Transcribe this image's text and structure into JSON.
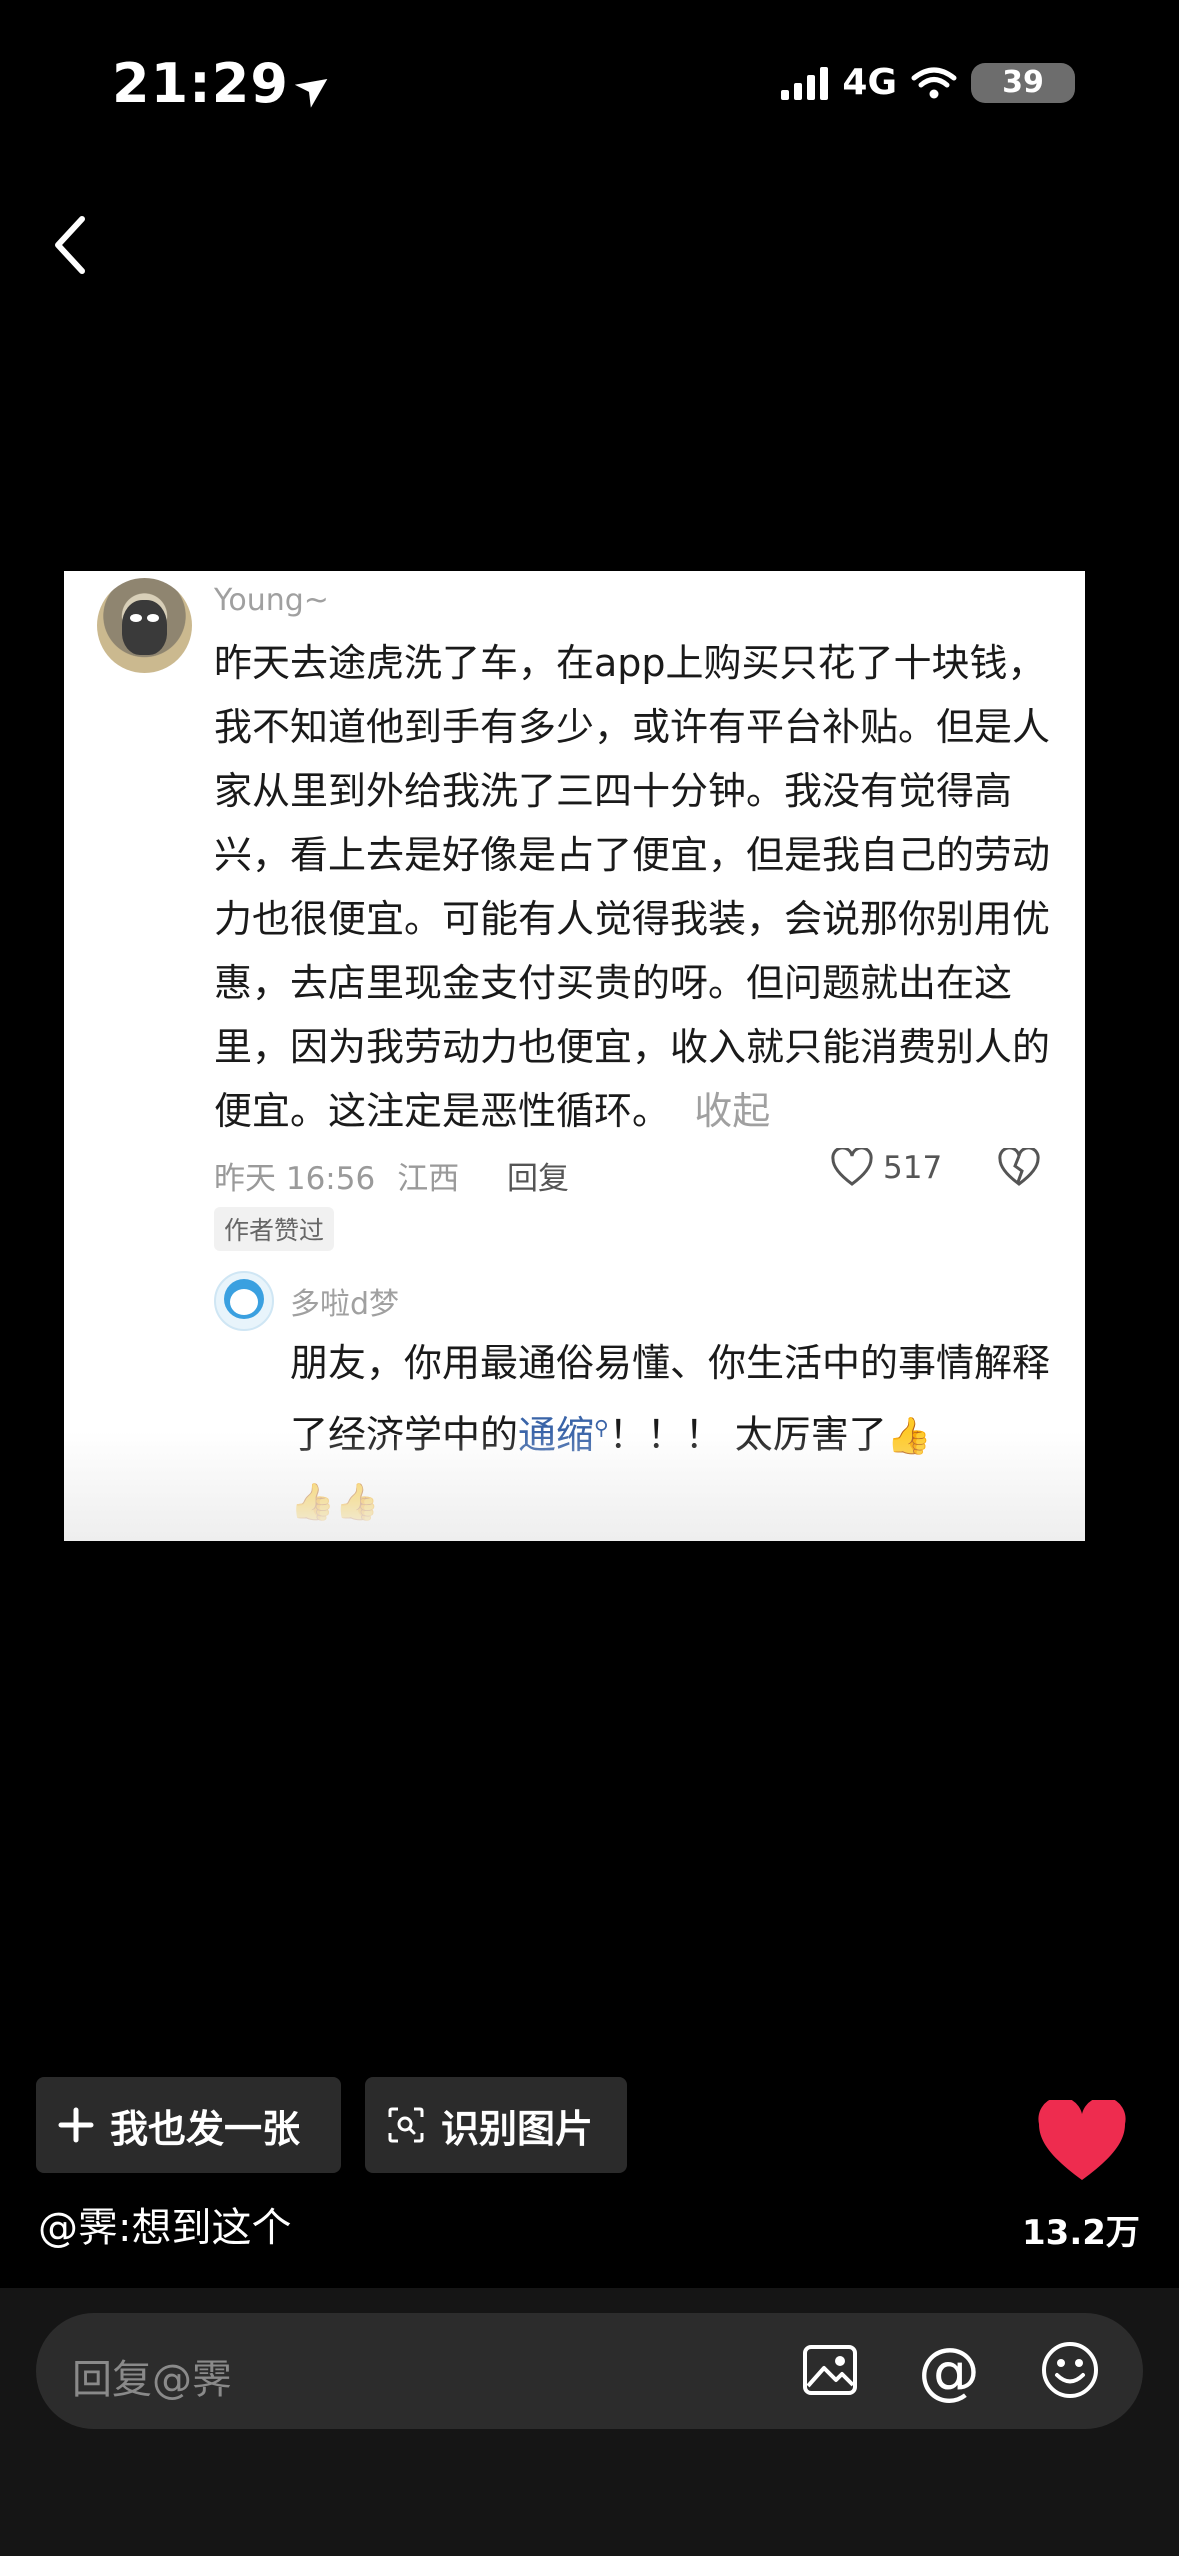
{
  "status_bar": {
    "time": "21:29",
    "network": "4G",
    "battery": "39"
  },
  "card": {
    "comment1": {
      "username": "Young~",
      "text": "昨天去途虎洗了车，在app上购买只花了十块钱，我不知道他到手有多少，或许有平台补贴。但是人家从里到外给我洗了三四十分钟。我没有觉得高兴，看上去是好像是占了便宜，但是我自己的劳动力也很便宜。可能有人觉得我装，会说那你别用优惠，去店里现金支付买贵的呀。但问题就出在这里，因为我劳动力也便宜，收入就只能消费别人的便宜。这注定是恶性循环。",
      "collapse_label": "收起",
      "time": "昨天 16:56",
      "location": "江西",
      "reply_label": "回复",
      "likes": "517",
      "author_liked": "作者赞过"
    },
    "comment2": {
      "username": "多啦d梦",
      "text_before": "朋友，你用最通俗易懂、你生活中的事情解释了经济学中的",
      "link_text": "通缩",
      "text_after": "！！！ 太厉害了"
    }
  },
  "actions": {
    "post_label": "我也发一张",
    "recognize_label": "识别图片"
  },
  "caption": "@霁:想到这个",
  "likes_count": "13.2万",
  "reply_bar": {
    "placeholder": "回复@霁"
  },
  "colors": {
    "heart": "#ee2c4f",
    "link": "#3a64a8",
    "background": "#000000"
  }
}
